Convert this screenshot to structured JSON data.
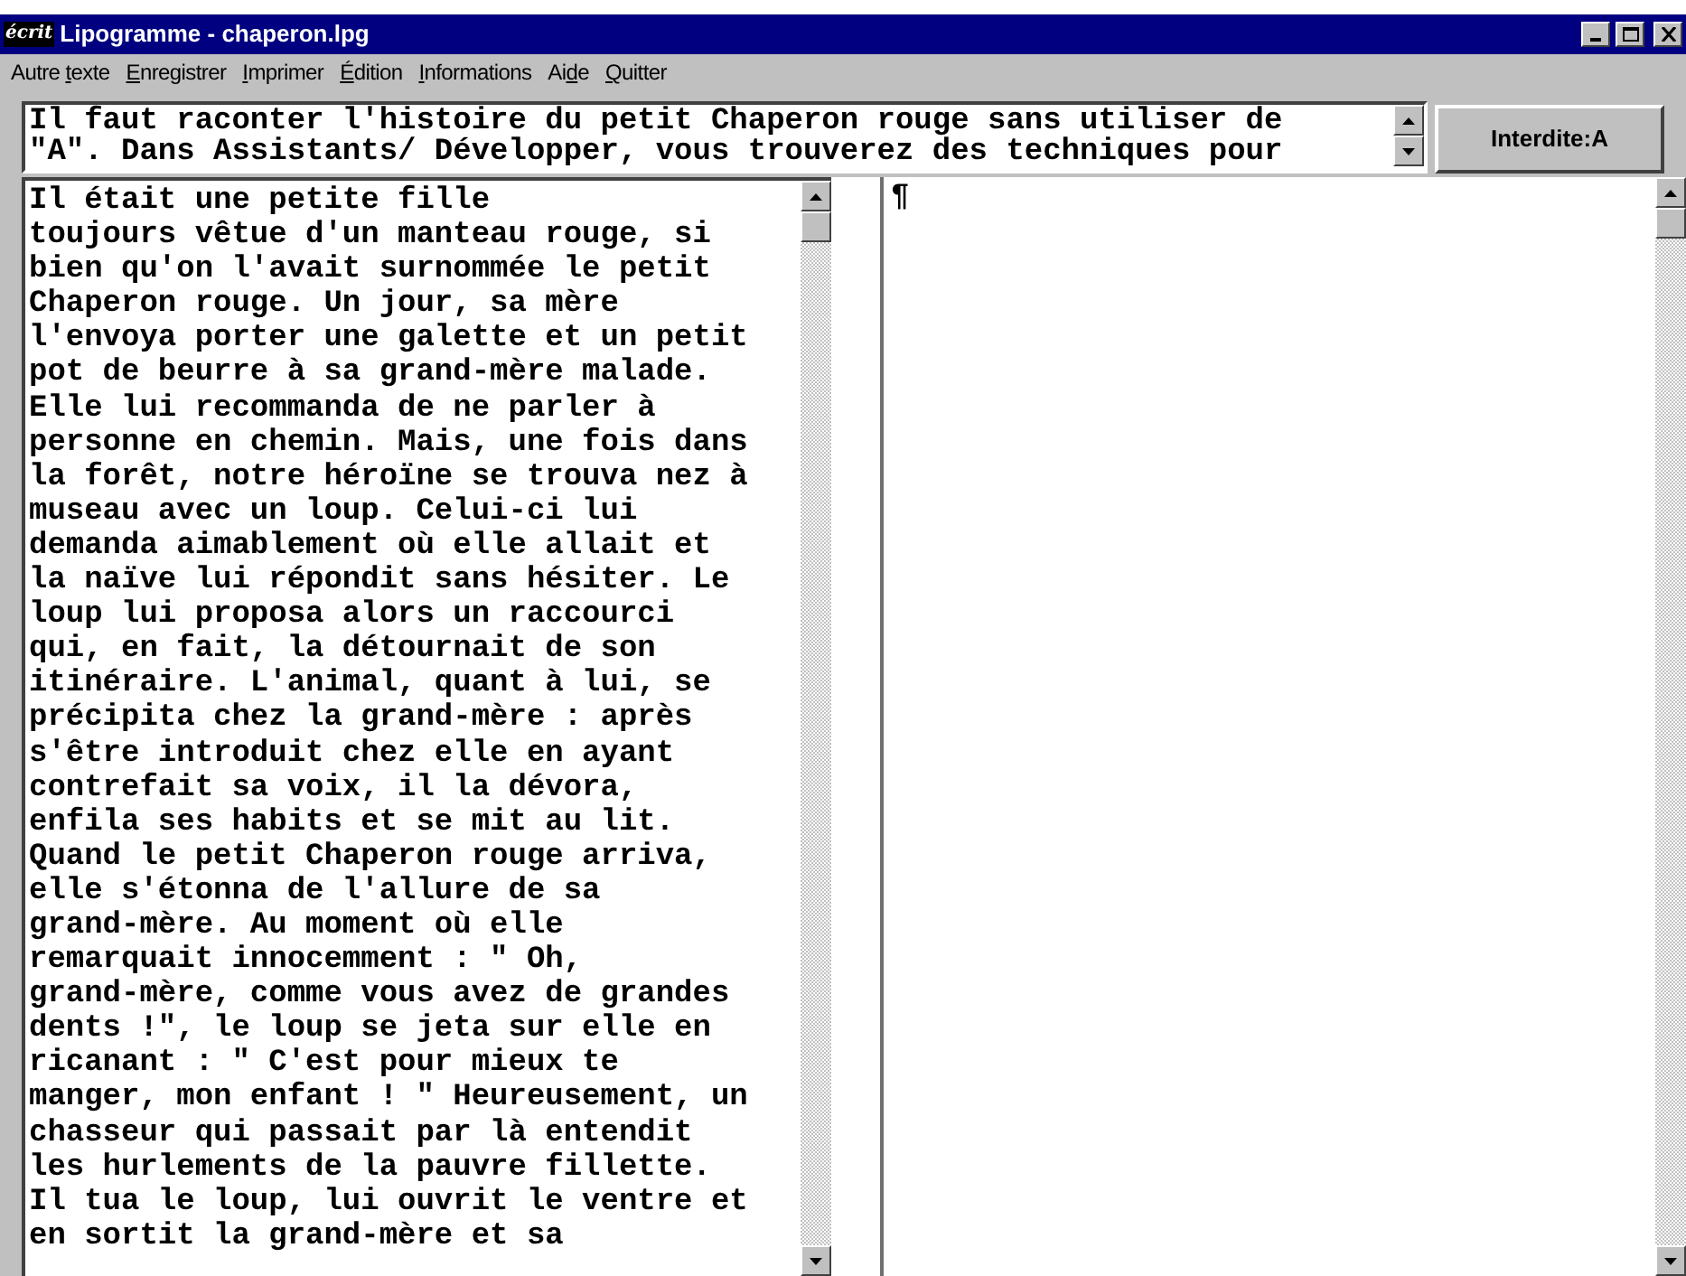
{
  "window": {
    "title": "Lipogramme - chaperon.lpg",
    "app_icon_text": "écrit"
  },
  "menu": [
    {
      "before": "Autre ",
      "key": "t",
      "after": "exte"
    },
    {
      "key": "E",
      "after": "nregistrer"
    },
    {
      "key": "I",
      "after": "mprimer"
    },
    {
      "key": "É",
      "after": "dition"
    },
    {
      "key": "I",
      "after": "nformations"
    },
    {
      "before": "Ai",
      "key": "d",
      "after": "e"
    },
    {
      "key": "Q",
      "after": "uitter"
    }
  ],
  "instructions": [
    "Il faut raconter l'histoire du petit Chaperon rouge sans utiliser de",
    "\"A\". Dans Assistants/ Développer, vous trouverez des techniques pour"
  ],
  "forbidden_button": "Interdite:A",
  "source_text": [
    "Il était une petite fille",
    "toujours vêtue d'un manteau rouge, si",
    "bien qu'on l'avait surnommée le petit",
    "Chaperon rouge. Un jour, sa mère",
    "l'envoya porter une galette et un petit",
    "pot de beurre à sa grand-mère malade.",
    "Elle lui recommanda de ne parler à",
    "personne en chemin. Mais, une fois dans",
    "la forêt, notre héroïne se trouva nez à",
    "museau avec un loup. Celui-ci lui",
    "demanda aimablement où elle allait et",
    "la naïve lui répondit sans hésiter. Le",
    "loup lui proposa alors un raccourci",
    "qui, en fait, la détournait de son",
    "itinéraire. L'animal, quant à lui, se",
    "précipita chez la grand-mère : après",
    "s'être introduit chez elle en ayant",
    "contrefait sa voix, il la dévora,",
    "enfila ses habits et se mit au lit.",
    "Quand le petit Chaperon rouge arriva,",
    "elle s'étonna de l'allure de sa",
    "grand-mère. Au moment où elle",
    "remarquait innocemment : \" Oh,",
    "grand-mère, comme vous avez de grandes",
    "dents !\", le loup se jeta sur elle en",
    "ricanant : \" C'est pour mieux te",
    "manger, mon enfant ! \" Heureusement, un",
    "chasseur qui passait par là entendit",
    "les hurlements de la pauvre fillette.",
    "Il tua le loup, lui ouvrit le ventre et",
    "en sortit la grand-mère et sa"
  ],
  "rewrite_text": [
    "¶"
  ]
}
